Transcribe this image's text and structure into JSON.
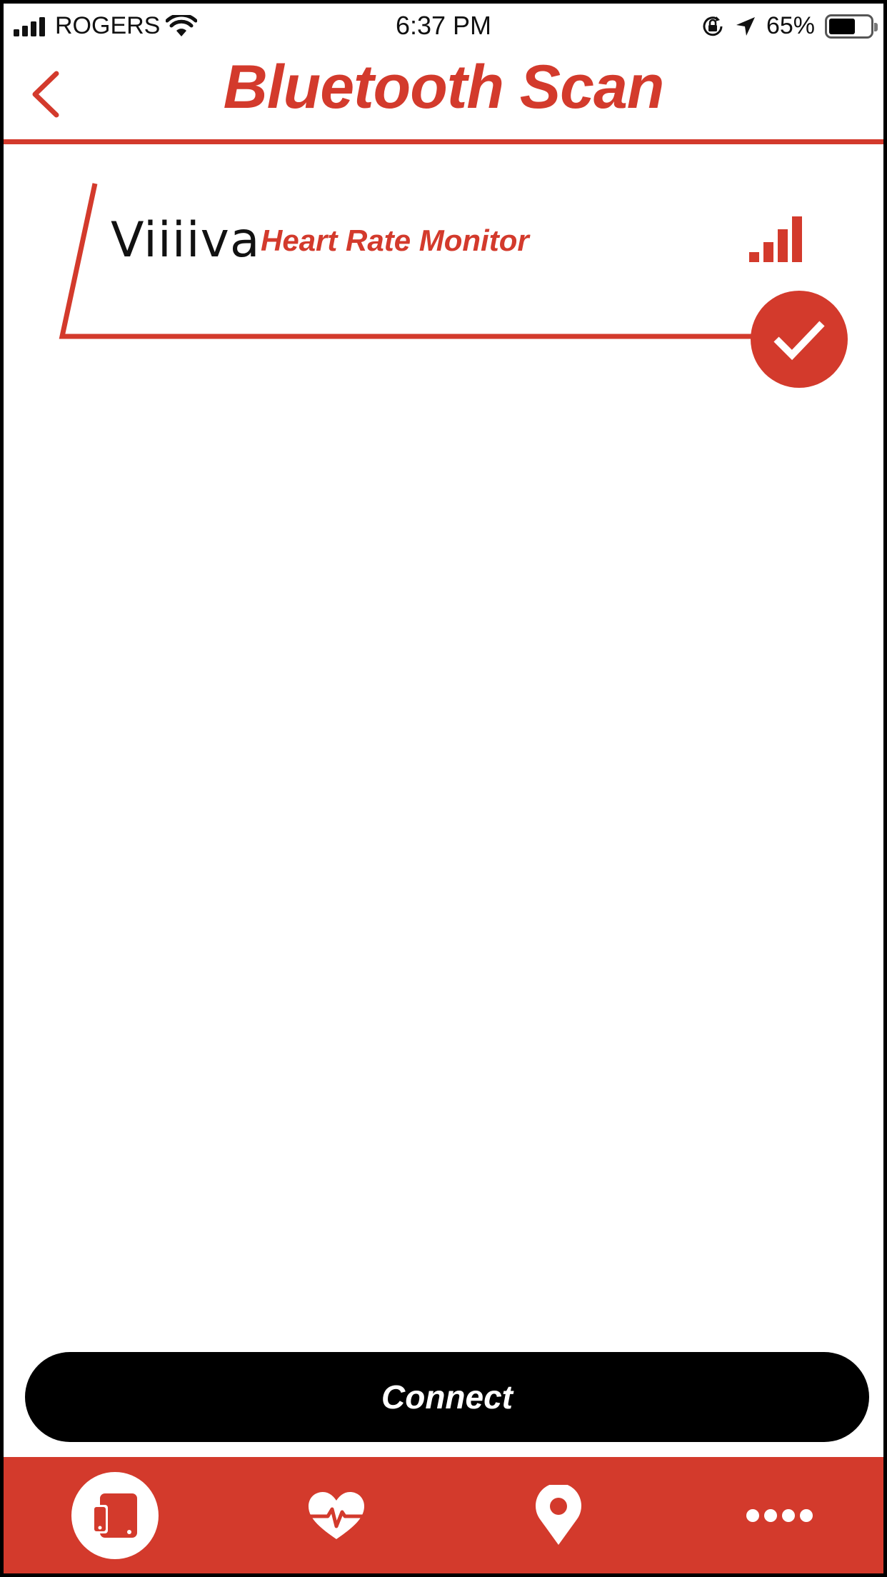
{
  "status_bar": {
    "carrier": "ROGERS",
    "time": "6:37 PM",
    "battery_percent": "65%",
    "battery_level": 0.65
  },
  "header": {
    "title": "Bluetooth Scan"
  },
  "device_list": [
    {
      "name": "Viiiiva",
      "type": "Heart Rate Monitor",
      "signal_bars": 4,
      "selected": true
    }
  ],
  "connect_label": "Connect",
  "tab_bar": {
    "tabs": [
      {
        "icon": "device-icon",
        "active": true
      },
      {
        "icon": "heart-rate-icon",
        "active": false
      },
      {
        "icon": "location-pin-icon",
        "active": false
      },
      {
        "icon": "more-icon",
        "active": false
      }
    ]
  },
  "colors": {
    "accent": "#d33a2c",
    "button": "#000000"
  }
}
